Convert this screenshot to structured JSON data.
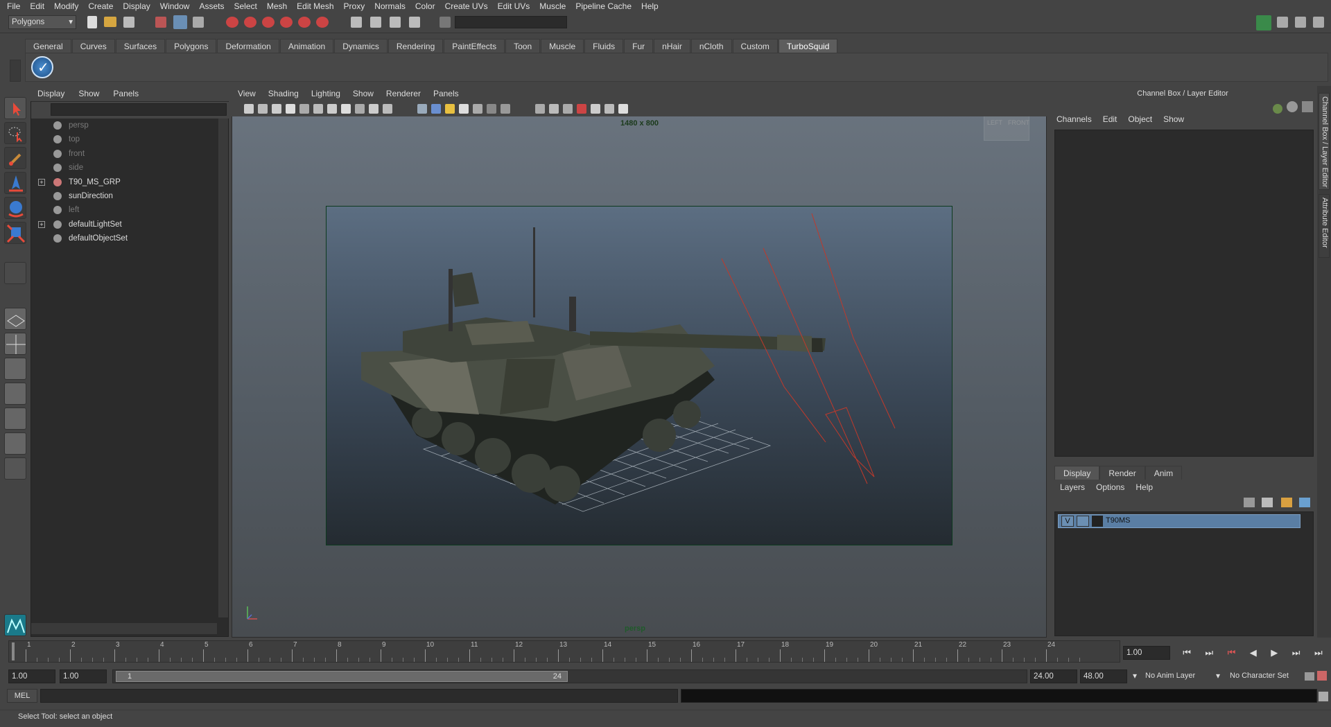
{
  "menubar": [
    "File",
    "Edit",
    "Modify",
    "Create",
    "Display",
    "Window",
    "Assets",
    "Select",
    "Mesh",
    "Edit Mesh",
    "Proxy",
    "Normals",
    "Color",
    "Create UVs",
    "Edit UVs",
    "Muscle",
    "Pipeline Cache",
    "Help"
  ],
  "status": {
    "mode_selector": "Polygons"
  },
  "shelf": {
    "tabs": [
      "General",
      "Curves",
      "Surfaces",
      "Polygons",
      "Deformation",
      "Animation",
      "Dynamics",
      "Rendering",
      "PaintEffects",
      "Toon",
      "Muscle",
      "Fluids",
      "Fur",
      "nHair",
      "nCloth",
      "Custom",
      "TurboSquid"
    ],
    "active": "TurboSquid"
  },
  "outliner": {
    "menu": [
      "Display",
      "Show",
      "Panels"
    ],
    "items": [
      {
        "label": "persp",
        "dim": true,
        "expand": false
      },
      {
        "label": "top",
        "dim": true,
        "expand": false
      },
      {
        "label": "front",
        "dim": true,
        "expand": false
      },
      {
        "label": "side",
        "dim": true,
        "expand": false
      },
      {
        "label": "T90_MS_GRP",
        "dim": false,
        "expand": true
      },
      {
        "label": "sunDirection",
        "dim": false,
        "expand": false
      },
      {
        "label": "left",
        "dim": true,
        "expand": false
      },
      {
        "label": "defaultLightSet",
        "dim": false,
        "expand": true
      },
      {
        "label": "defaultObjectSet",
        "dim": false,
        "expand": false
      }
    ]
  },
  "viewport": {
    "menu": [
      "View",
      "Shading",
      "Lighting",
      "Show",
      "Renderer",
      "Panels"
    ],
    "resolution": "1480 x 800",
    "camera": "persp",
    "cube_left": "LEFT",
    "cube_front": "FRONT"
  },
  "channel_box": {
    "title": "Channel Box / Layer Editor",
    "menu": [
      "Channels",
      "Edit",
      "Object",
      "Show"
    ]
  },
  "layer_editor": {
    "tabs": [
      "Display",
      "Render",
      "Anim"
    ],
    "active": "Display",
    "menu": [
      "Layers",
      "Options",
      "Help"
    ],
    "layer": {
      "visible": "V",
      "name": "T90MS"
    }
  },
  "side_tabs": [
    "Channel Box / Layer Editor",
    "Attribute Editor"
  ],
  "timeline": {
    "ticks": [
      "1",
      "2",
      "3",
      "4",
      "5",
      "6",
      "7",
      "8",
      "9",
      "10",
      "11",
      "12",
      "13",
      "14",
      "15",
      "16",
      "17",
      "18",
      "19",
      "20",
      "21",
      "22",
      "23",
      "24"
    ],
    "current_frame": "1.00"
  },
  "range": {
    "start": "1.00",
    "anim_start": "1.00",
    "slider_start": "1",
    "slider_end": "24",
    "anim_end": "24.00",
    "end": "48.00",
    "anim_layer": "No Anim Layer",
    "char_set": "No Character Set"
  },
  "command": {
    "label": "MEL"
  },
  "help": {
    "text": "Select Tool: select an object"
  }
}
